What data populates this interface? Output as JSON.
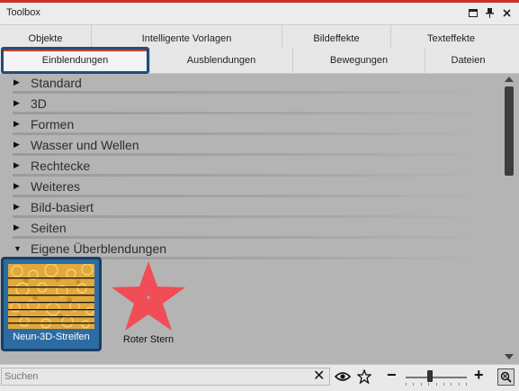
{
  "window": {
    "title": "Toolbox",
    "accent": "#c8312c"
  },
  "tabs_row1": [
    {
      "label": "Objekte"
    },
    {
      "label": "Intelligente Vorlagen"
    },
    {
      "label": "Bildeffekte"
    },
    {
      "label": "Texteffekte"
    }
  ],
  "tabs_row2": [
    {
      "label": "Einblendungen",
      "active": true
    },
    {
      "label": "Ausblendungen"
    },
    {
      "label": "Bewegungen"
    },
    {
      "label": "Dateien"
    }
  ],
  "categories": [
    {
      "label": "Standard",
      "expanded": false
    },
    {
      "label": "3D",
      "expanded": false
    },
    {
      "label": "Formen",
      "expanded": false
    },
    {
      "label": "Wasser und Wellen",
      "expanded": false
    },
    {
      "label": "Rechtecke",
      "expanded": false
    },
    {
      "label": "Weiteres",
      "expanded": false
    },
    {
      "label": "Bild-basiert",
      "expanded": false
    },
    {
      "label": "Seiten",
      "expanded": false
    },
    {
      "label": "Eigene Überblendungen",
      "expanded": true
    }
  ],
  "items": [
    {
      "name": "Neun-3D-Streifen",
      "selected": true
    },
    {
      "name": "Roter Stern",
      "selected": false
    }
  ],
  "search": {
    "placeholder": "Suchen",
    "value": ""
  },
  "icons": {
    "float": "float-window-icon",
    "pin": "pin-icon",
    "close": "close-icon",
    "clear": "clear-search-icon",
    "eye": "eye-icon",
    "star": "favorite-star-icon",
    "minus": "zoom-out-icon",
    "plus": "zoom-in-icon",
    "reset": "zoom-reset-icon"
  },
  "zoom": {
    "level": 0.4
  },
  "colors": {
    "selection": "#2d6ca2",
    "tab_focus": "#1f4e79",
    "star": "#f04d57"
  }
}
